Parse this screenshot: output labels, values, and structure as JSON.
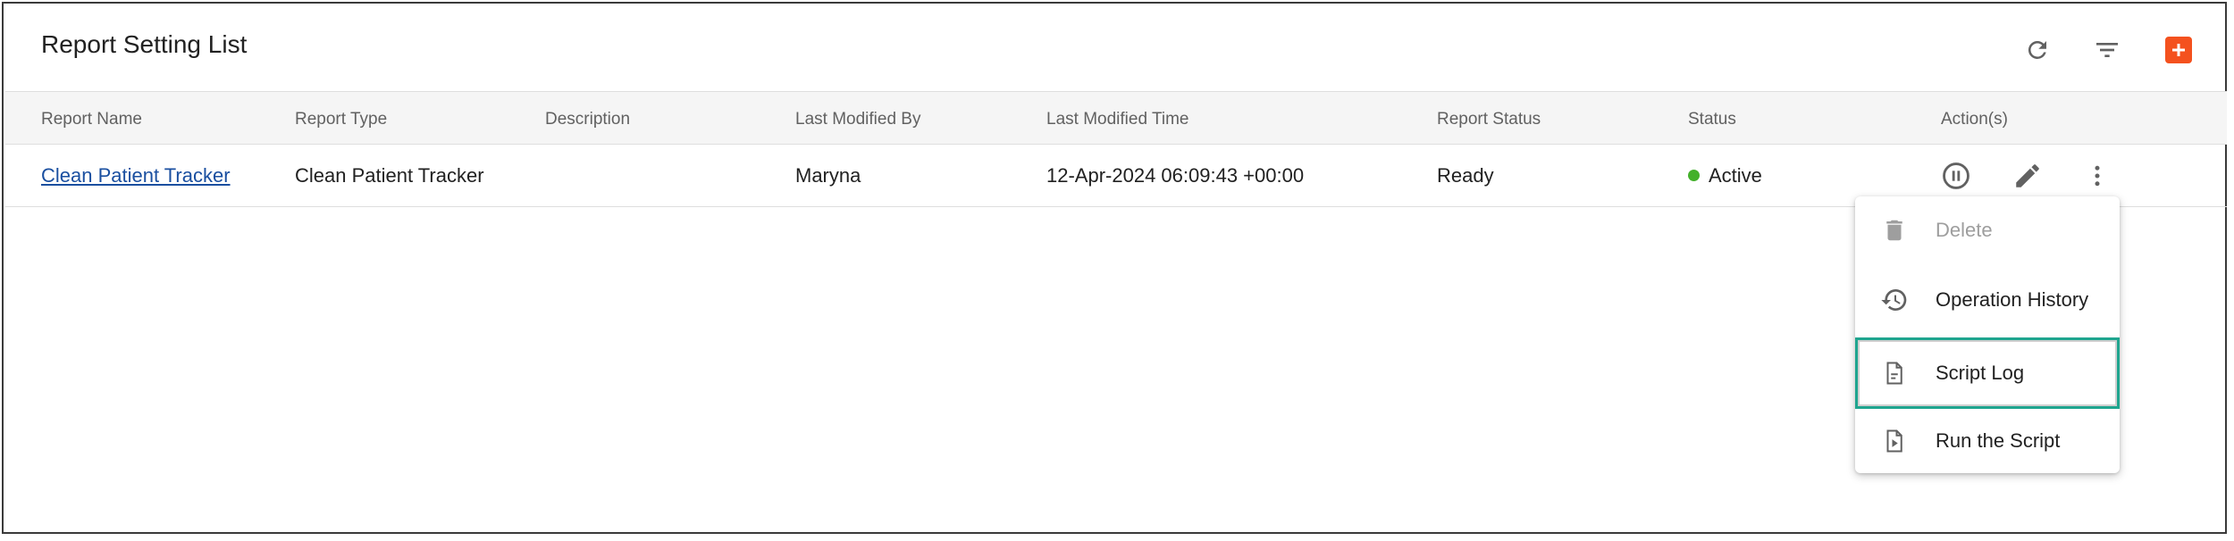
{
  "page": {
    "title": "Report Setting List"
  },
  "toolbar": {
    "refresh_icon": "refresh-icon",
    "filter_icon": "filter-icon",
    "add_icon": "add-icon",
    "accent": "#f4511e"
  },
  "table": {
    "columns": [
      "Report Name",
      "Report Type",
      "Description",
      "Last Modified By",
      "Last Modified Time",
      "Report Status",
      "Status",
      "Action(s)"
    ],
    "rows": [
      {
        "report_name": "Clean Patient Tracker",
        "report_type": "Clean Patient Tracker",
        "description": "",
        "last_modified_by": "Maryna",
        "last_modified_time": "12-Apr-2024 06:09:43 +00:00",
        "report_status": "Ready",
        "status": "Active",
        "status_color": "#43b02a"
      }
    ]
  },
  "context_menu": {
    "items": [
      {
        "label": "Delete",
        "icon": "trash-icon",
        "disabled": true
      },
      {
        "label": "Operation History",
        "icon": "history-icon",
        "disabled": false
      },
      {
        "label": "Script Log",
        "icon": "document-icon",
        "disabled": false,
        "selected": true
      },
      {
        "label": "Run the Script",
        "icon": "run-file-icon",
        "disabled": false
      }
    ],
    "highlight_color": "#1fa58f"
  }
}
